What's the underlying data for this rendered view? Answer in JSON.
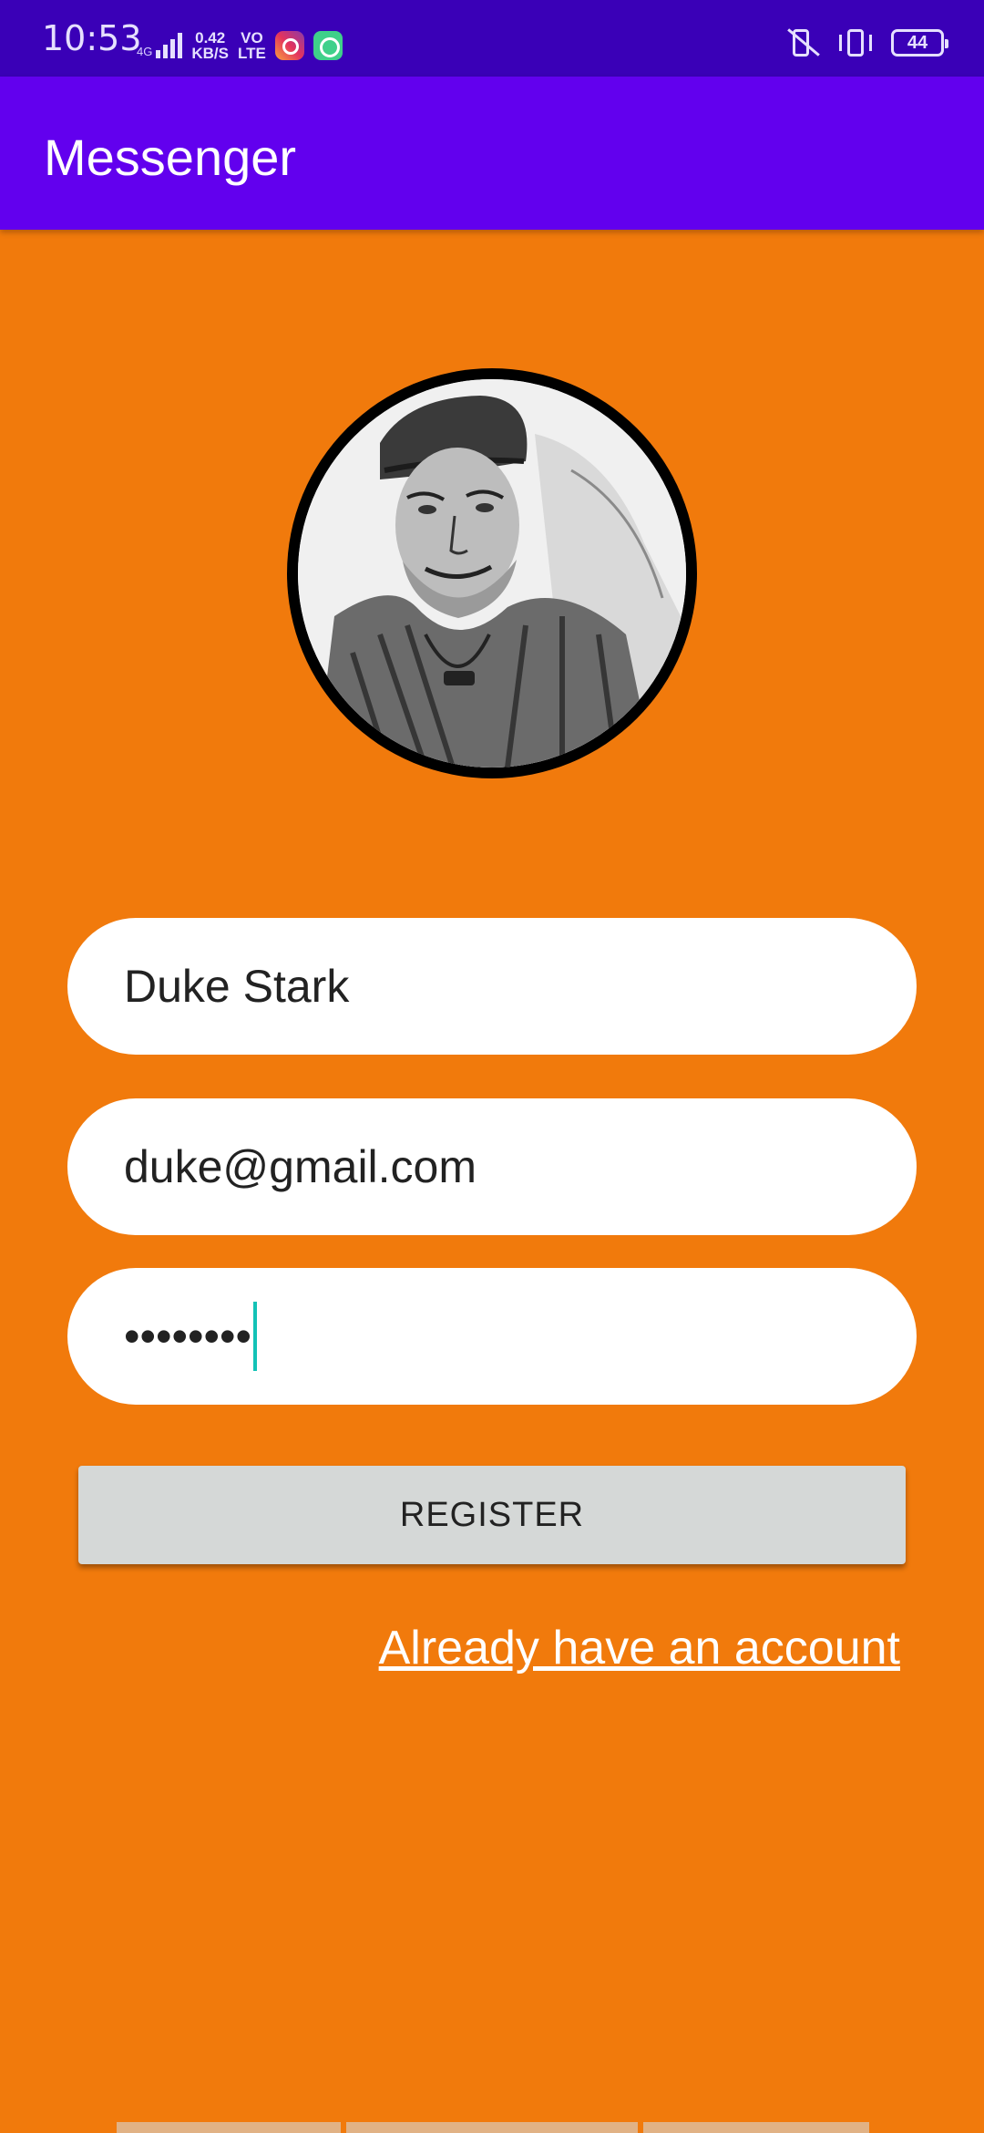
{
  "status_bar": {
    "time": "10:53",
    "network_label": "4G",
    "data_speed_value": "0.42",
    "data_speed_unit": "KB/S",
    "volte_top": "VO",
    "volte_bottom": "LTE",
    "battery_level": "44",
    "icons": [
      "signal-icon",
      "instagram-icon",
      "chat-app-icon",
      "mute-vibrate-icon",
      "vibrate-icon",
      "battery-icon"
    ]
  },
  "app_bar": {
    "title": "Messenger",
    "color": "#6200EE"
  },
  "avatar": {
    "icon": "profile-avatar"
  },
  "form": {
    "name_value": "Duke Stark",
    "email_value": "duke@gmail.com",
    "password_masked": "••••••••"
  },
  "register_button": {
    "label": "REGISTER"
  },
  "login_link": {
    "label": "Already have an account"
  },
  "colors": {
    "background": "#F17A0C",
    "status_bar": "#3A00B7",
    "app_bar": "#6200EE",
    "button": "#D5D8D7",
    "caret": "#13C2B6"
  }
}
